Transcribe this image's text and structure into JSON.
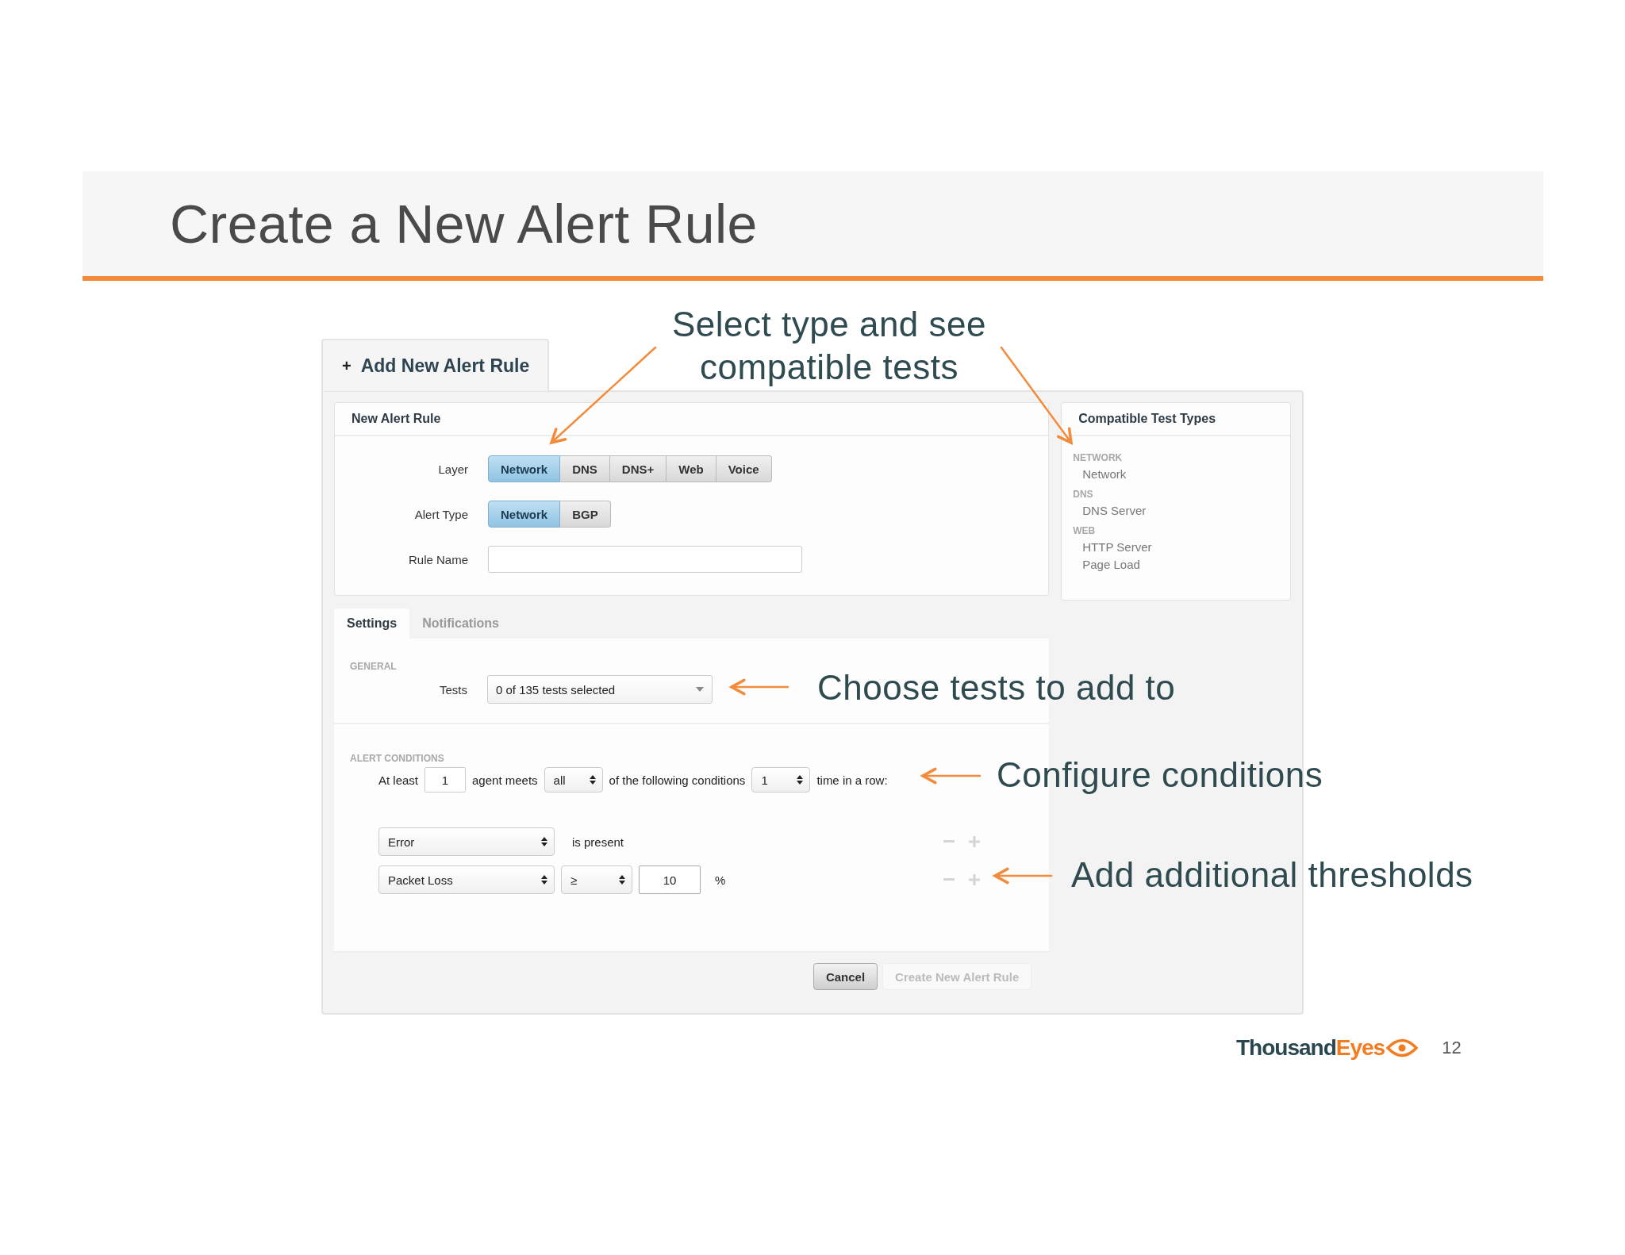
{
  "slide": {
    "title": "Create a New Alert Rule",
    "page_number": "12",
    "logo": {
      "parts": [
        "Thousand",
        "Eyes"
      ]
    }
  },
  "window_tab": {
    "icon": "+",
    "label": "Add New Alert Rule"
  },
  "new_rule": {
    "title": "New Alert Rule",
    "layer": {
      "label": "Layer",
      "options": [
        {
          "label": "Network",
          "selected": true
        },
        {
          "label": "DNS",
          "selected": false
        },
        {
          "label": "DNS+",
          "selected": false
        },
        {
          "label": "Web",
          "selected": false
        },
        {
          "label": "Voice",
          "selected": false
        }
      ]
    },
    "alert_type": {
      "label": "Alert Type",
      "options": [
        {
          "label": "Network",
          "selected": true
        },
        {
          "label": "BGP",
          "selected": false
        }
      ]
    },
    "rule_name": {
      "label": "Rule Name"
    }
  },
  "compatible": {
    "title": "Compatible Test Types",
    "groups": [
      {
        "heading": "NETWORK",
        "items": [
          "Network"
        ]
      },
      {
        "heading": "DNS",
        "items": [
          "DNS Server"
        ]
      },
      {
        "heading": "WEB",
        "items": [
          "HTTP Server",
          "Page Load"
        ]
      }
    ]
  },
  "tabs": [
    {
      "label": "Settings",
      "selected": true
    },
    {
      "label": "Notifications",
      "selected": false
    }
  ],
  "general": {
    "heading": "GENERAL",
    "tests": {
      "label": "Tests",
      "value": "0 of 135 tests selected"
    }
  },
  "conditions": {
    "heading": "ALERT CONDITIONS",
    "sentence": [
      {
        "kind": "text",
        "value": "At least"
      },
      {
        "kind": "input",
        "value": "1"
      },
      {
        "kind": "text",
        "value": "agent meets"
      },
      {
        "kind": "small-select",
        "value": "all"
      },
      {
        "kind": "text",
        "value": "of the following conditions"
      },
      {
        "kind": "small-select",
        "value": "1"
      },
      {
        "kind": "text",
        "value": "time in a row:"
      }
    ],
    "rows": [
      {
        "parts": [
          {
            "kind": "metric-select",
            "value": "Error"
          },
          {
            "kind": "text",
            "value": "is present"
          }
        ]
      },
      {
        "parts": [
          {
            "kind": "metric-select",
            "value": "Packet Loss"
          },
          {
            "kind": "operator-select",
            "value": "≥"
          },
          {
            "kind": "input",
            "value": "10"
          },
          {
            "kind": "text",
            "value": "%"
          }
        ]
      }
    ]
  },
  "buttons": [
    {
      "label": "Cancel",
      "disabled": false
    },
    {
      "label": "Create New Alert Rule",
      "disabled": true
    }
  ],
  "annotations": [
    {
      "lines": [
        "Select type and see",
        "compatible tests"
      ]
    },
    {
      "lines": [
        "Choose tests to add to"
      ]
    },
    {
      "lines": [
        "Configure conditions"
      ]
    },
    {
      "lines": [
        "Add additional thresholds"
      ]
    }
  ]
}
